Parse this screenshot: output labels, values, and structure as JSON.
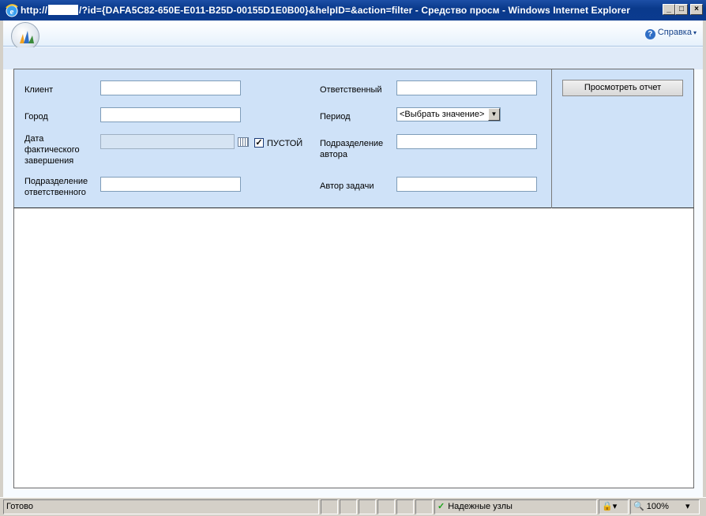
{
  "window": {
    "title_prefix": "http://",
    "title_suffix": "/?id={DAFA5C82-650E-E011-B25D-00155D1E0B00}&helpID=&action=filter - Средство просм - Windows Internet Explorer",
    "min_label": "_",
    "max_label": "□",
    "close_label": "×"
  },
  "header": {
    "help_label": "Справка",
    "help_icon_glyph": "?",
    "help_caret": "▾"
  },
  "filter": {
    "client_label": "Клиент",
    "client_value": "",
    "city_label": "Город",
    "city_value": "",
    "date_label_1": "Дата",
    "date_label_2": "фактического",
    "date_label_3": "завершения",
    "date_value": "",
    "empty_label": "ПУСТОЙ",
    "empty_checked": true,
    "check_glyph": "✓",
    "dept_resp_label_1": "Подразделение",
    "dept_resp_label_2": "ответственного",
    "dept_resp_value": "",
    "responsible_label": "Ответственный",
    "responsible_value": "",
    "period_label": "Период",
    "period_value": "<Выбрать значение>",
    "period_arrow": "▼",
    "dept_author_label_1": "Подразделение",
    "dept_author_label_2": "автора",
    "dept_author_value": "",
    "task_author_label": "Автор задачи",
    "task_author_value": "",
    "view_report_button": "Просмотреть отчет"
  },
  "statusbar": {
    "status_text": "Готово",
    "zone_text": "Надежные узлы",
    "zone_check": "✓",
    "zoom_text": "100%",
    "zoom_caret": "▾",
    "zoom_glyph": "🔍",
    "protect_caret": "▾"
  }
}
